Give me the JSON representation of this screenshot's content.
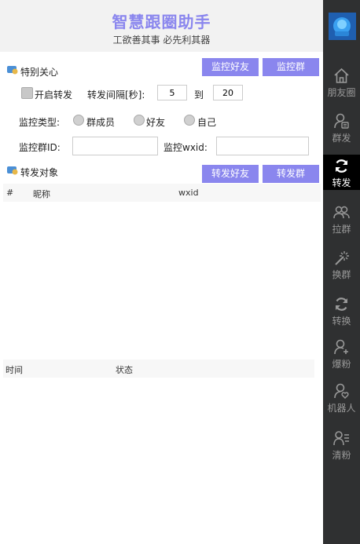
{
  "header": {
    "title": "智慧跟圈助手",
    "subtitle": "工欲善其事 必先利其器"
  },
  "special_care": {
    "section_title": "特别关心",
    "monitor_friends_button": "监控好友",
    "monitor_groups_button": "监控群",
    "enable_forward_label": "开启转发",
    "enable_forward_checked": false,
    "interval_label": "转发间隔[秒]:",
    "interval_from": "5",
    "to_label": "到",
    "interval_to": "20",
    "monitor_type_label": "监控类型:",
    "monitor_type_options": [
      "群成员",
      "好友",
      "自己"
    ],
    "group_id_label": "监控群ID:",
    "group_id_value": "",
    "wxid_label": "监控wxid:",
    "wxid_value": ""
  },
  "forward_target": {
    "section_title": "转发对象",
    "forward_friends_button": "转发好友",
    "forward_groups_button": "转发群",
    "columns": [
      "#",
      "昵称",
      "wxid"
    ],
    "rows": []
  },
  "log": {
    "columns": [
      "时间",
      "状态"
    ],
    "rows": []
  },
  "sidebar": {
    "items": [
      {
        "label": "朋友圈",
        "icon": "home-icon"
      },
      {
        "label": "群发",
        "icon": "user-message-icon"
      },
      {
        "label": "转发",
        "icon": "refresh-icon",
        "active": true
      },
      {
        "label": "拉群",
        "icon": "users-icon"
      },
      {
        "label": "换群",
        "icon": "magic-wand-icon"
      },
      {
        "label": "转换",
        "icon": "convert-icon"
      },
      {
        "label": "爆粉",
        "icon": "user-plus-icon"
      },
      {
        "label": "机器人",
        "icon": "user-heart-icon"
      },
      {
        "label": "清粉",
        "icon": "user-list-icon"
      }
    ]
  },
  "colors": {
    "accent": "#8a86ee",
    "sidebar_bg": "#2f3031",
    "sidebar_active_bg": "#000000"
  }
}
